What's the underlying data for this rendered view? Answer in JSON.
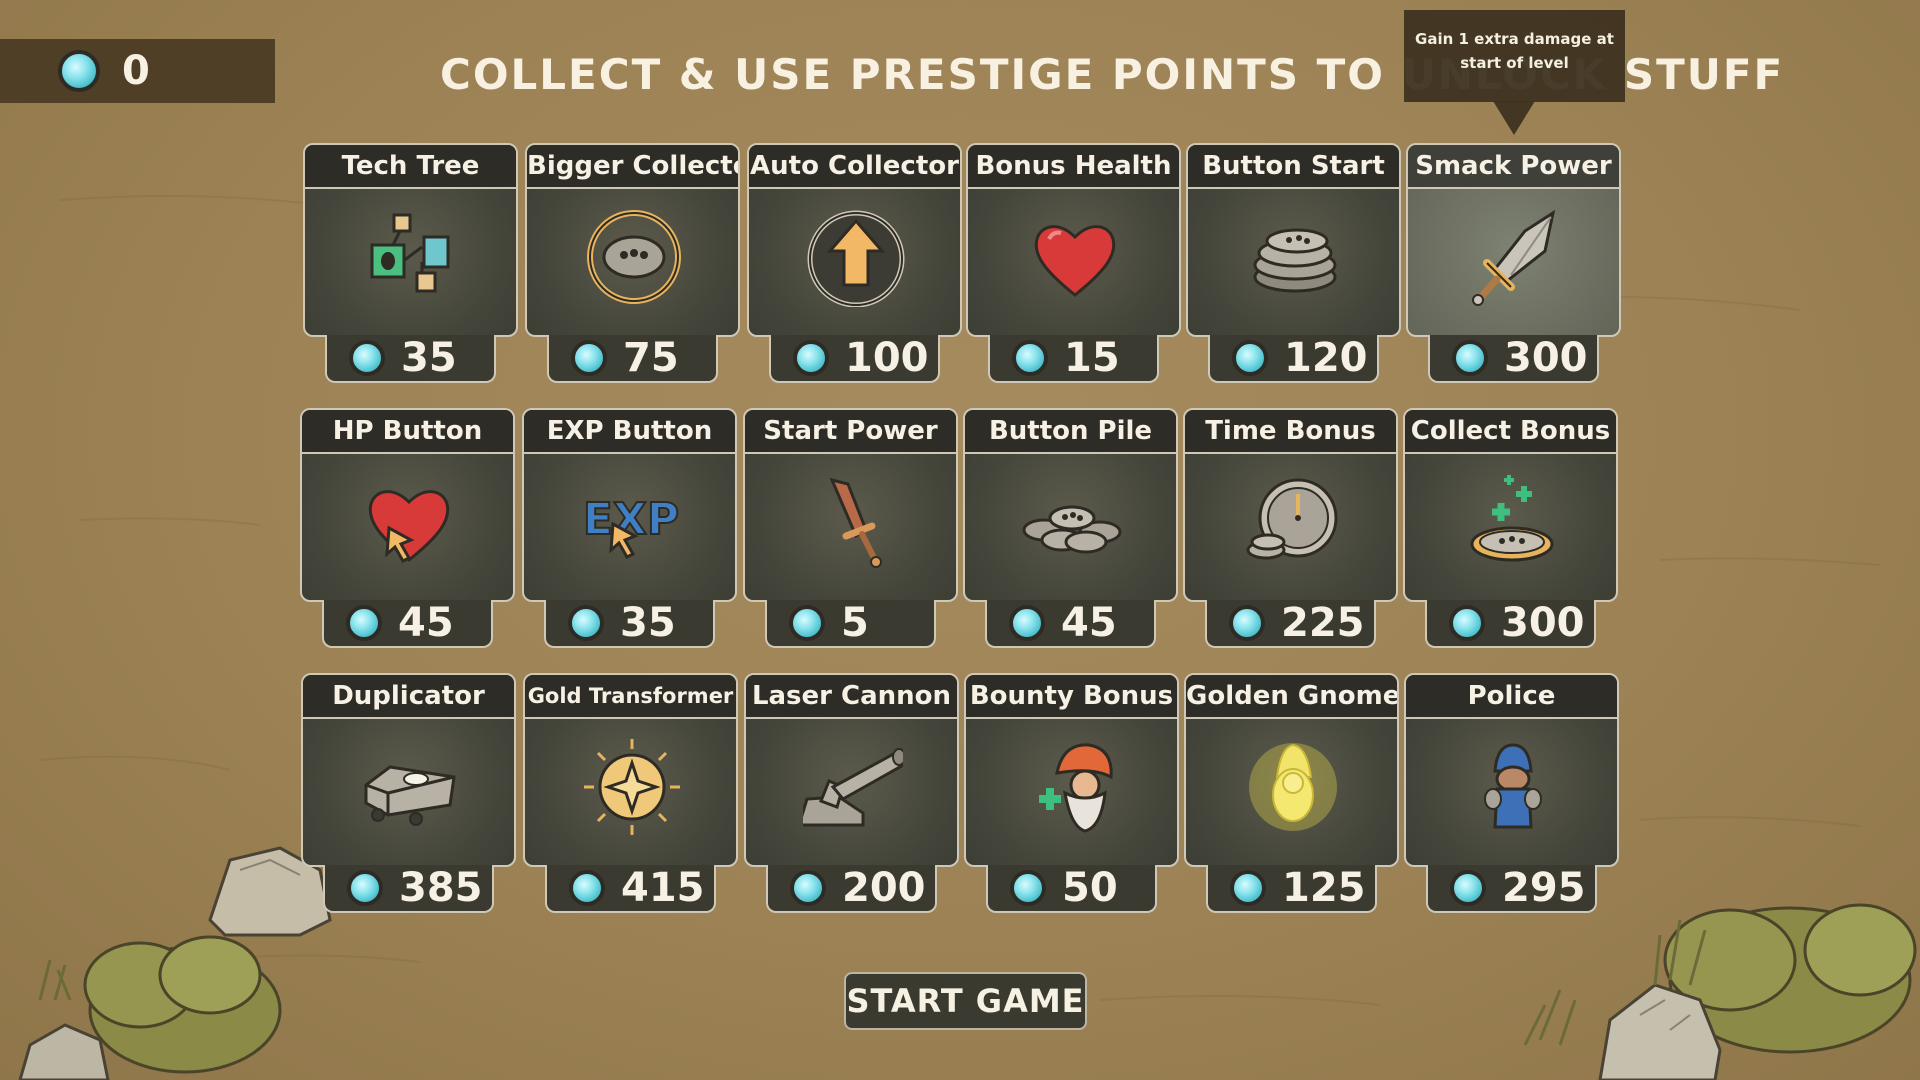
{
  "currency": {
    "icon": "prestige-gem-icon",
    "value": "0"
  },
  "headline": "COLLECT & USE PRESTIGE POINTS TO UNLOCK STUFF",
  "tooltip": {
    "line1": "Gain 1 extra damage at",
    "line2": "start of level"
  },
  "upgrades": [
    {
      "title": "Tech Tree",
      "icon": "tech-tree-icon",
      "price": "35"
    },
    {
      "title": "Bigger Collector",
      "icon": "ring-collector-icon",
      "price": "75"
    },
    {
      "title": "Auto Collector",
      "icon": "auto-collector-arrow-icon",
      "price": "100"
    },
    {
      "title": "Bonus Health",
      "icon": "heart-icon",
      "price": "15"
    },
    {
      "title": "Button Start",
      "icon": "button-stack-icon",
      "price": "120"
    },
    {
      "title": "Smack Power",
      "icon": "sword-icon",
      "price": "300"
    },
    {
      "title": "HP Button",
      "icon": "heart-cursor-icon",
      "price": "45"
    },
    {
      "title": "EXP Button",
      "icon": "exp-cursor-icon",
      "price": "35"
    },
    {
      "title": "Start Power",
      "icon": "bronze-sword-icon",
      "price": "5"
    },
    {
      "title": "Button Pile",
      "icon": "button-pile-icon",
      "price": "45"
    },
    {
      "title": "Time Bonus",
      "icon": "clock-icon",
      "price": "225"
    },
    {
      "title": "Collect Bonus",
      "icon": "plus-button-icon",
      "price": "300"
    },
    {
      "title": "Duplicator",
      "icon": "duplicator-machine-icon",
      "price": "385"
    },
    {
      "title": "Gold Transformer",
      "icon": "gold-star-coin-icon",
      "price": "415"
    },
    {
      "title": "Laser Cannon",
      "icon": "laser-cannon-icon",
      "price": "200"
    },
    {
      "title": "Bounty Bonus",
      "icon": "gnome-head-plus-icon",
      "price": "50"
    },
    {
      "title": "Golden Gnome",
      "icon": "golden-gnome-icon",
      "price": "125"
    },
    {
      "title": "Police",
      "icon": "police-gnome-icon",
      "price": "295"
    }
  ],
  "start_button": "START GAME",
  "colors": {
    "background": "#9c8254",
    "card": "#45463b",
    "title_bar": "#2d2c27",
    "gem": "#8fe5ee",
    "text": "#f6f1e4"
  }
}
